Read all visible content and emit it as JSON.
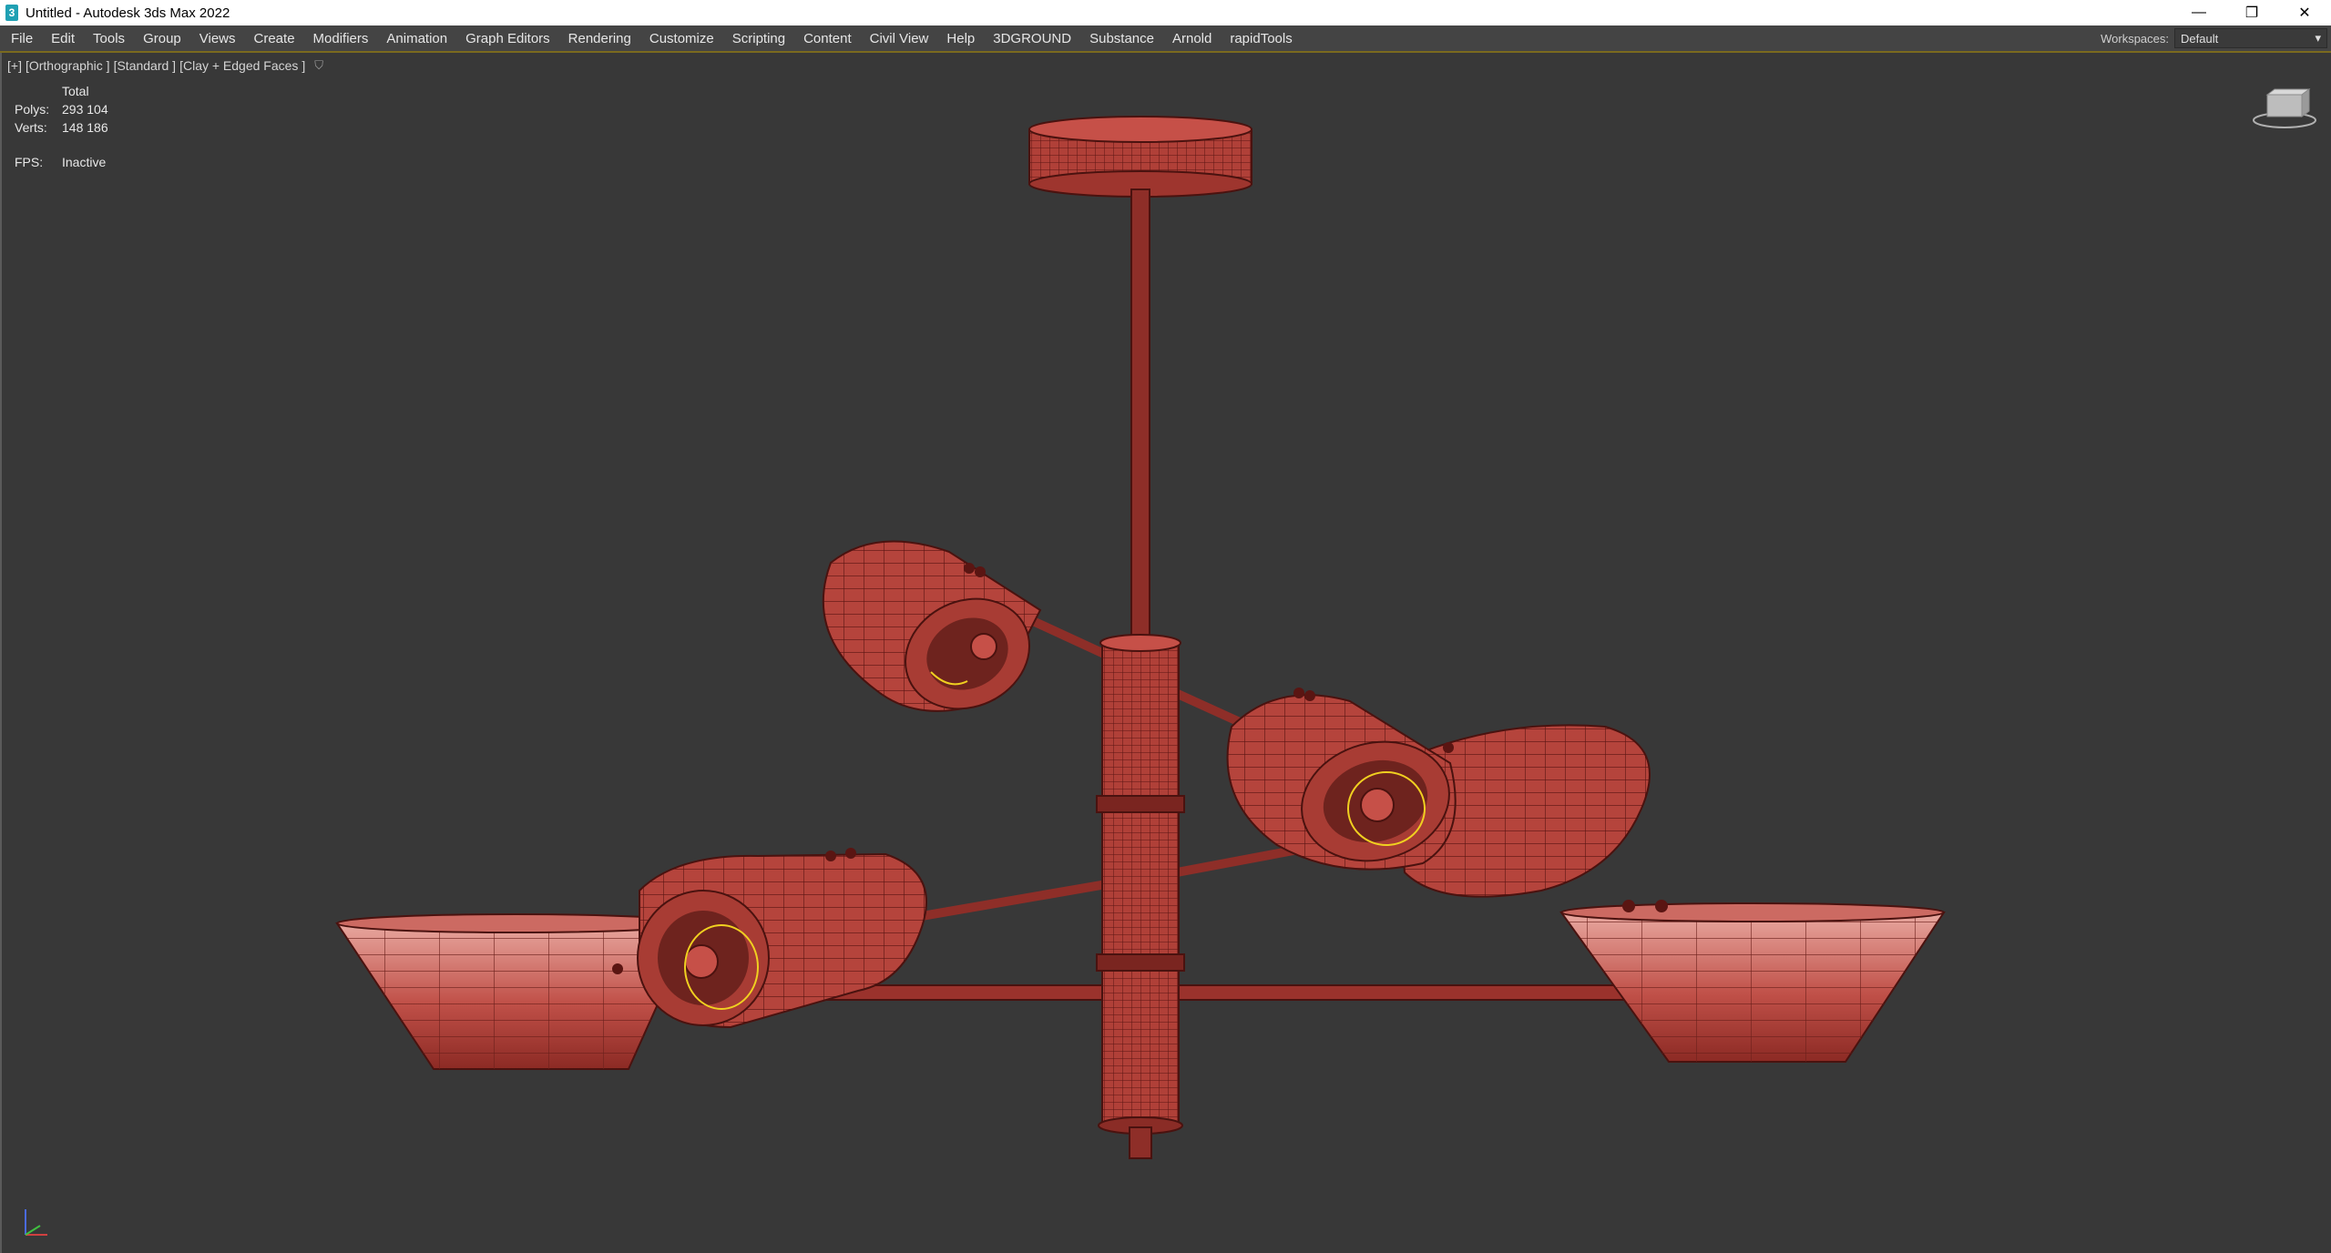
{
  "window": {
    "title": "Untitled - Autodesk 3ds Max 2022",
    "icon": "3ds-max-app-icon",
    "controls": {
      "minimize": "—",
      "restore": "❐",
      "close": "✕"
    }
  },
  "menu": {
    "items": [
      "File",
      "Edit",
      "Tools",
      "Group",
      "Views",
      "Create",
      "Modifiers",
      "Animation",
      "Graph Editors",
      "Rendering",
      "Customize",
      "Scripting",
      "Content",
      "Civil View",
      "Help",
      "3DGROUND",
      "Substance",
      "Arnold",
      "rapidTools"
    ],
    "workspaces_label": "Workspaces:",
    "workspaces_value": "Default"
  },
  "viewport": {
    "label_parts": [
      "[+]",
      "[Orthographic ]",
      "[Standard ]",
      "[Clay + Edged Faces ]"
    ],
    "stats": {
      "header": "Total",
      "polys_label": "Polys:",
      "polys_value": "293 104",
      "verts_label": "Verts:",
      "verts_value": "148 186",
      "fps_label": "FPS:",
      "fps_value": "Inactive"
    },
    "colors": {
      "background": "#383838",
      "mesh": "#b5443c",
      "wire": "#5a1512",
      "highlight": "#f0d020"
    }
  }
}
